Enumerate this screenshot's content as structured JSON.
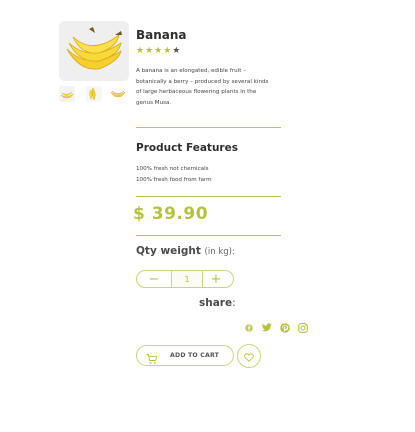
{
  "product": {
    "title": "Banana",
    "rating": {
      "filled": 4,
      "total": 5,
      "stars_filled": "★★★★",
      "stars_empty": "★"
    },
    "description": "A banana is an elongated, edible fruit – botanically a berry – produced by several kinds of large herbaceous flowering plants in the genus Musa.",
    "price": "$ 39.90"
  },
  "features": {
    "title": "Product Features",
    "items": [
      "100% fresh not chemicals",
      "100% fresh food from farm"
    ]
  },
  "quantity": {
    "label": "Qty weight",
    "unit": "(in kg)",
    "colon": ":",
    "minus": "−",
    "plus": "+",
    "value": "1"
  },
  "share": {
    "label": "share",
    "colon": ":",
    "icons": [
      "facebook-icon",
      "twitter-icon",
      "pinterest-icon",
      "instagram-icon"
    ]
  },
  "actions": {
    "add_to_cart": "ADD TO CART"
  },
  "colors": {
    "accent": "#b6c33a",
    "border": "#cbd47b",
    "text": "#333333"
  }
}
